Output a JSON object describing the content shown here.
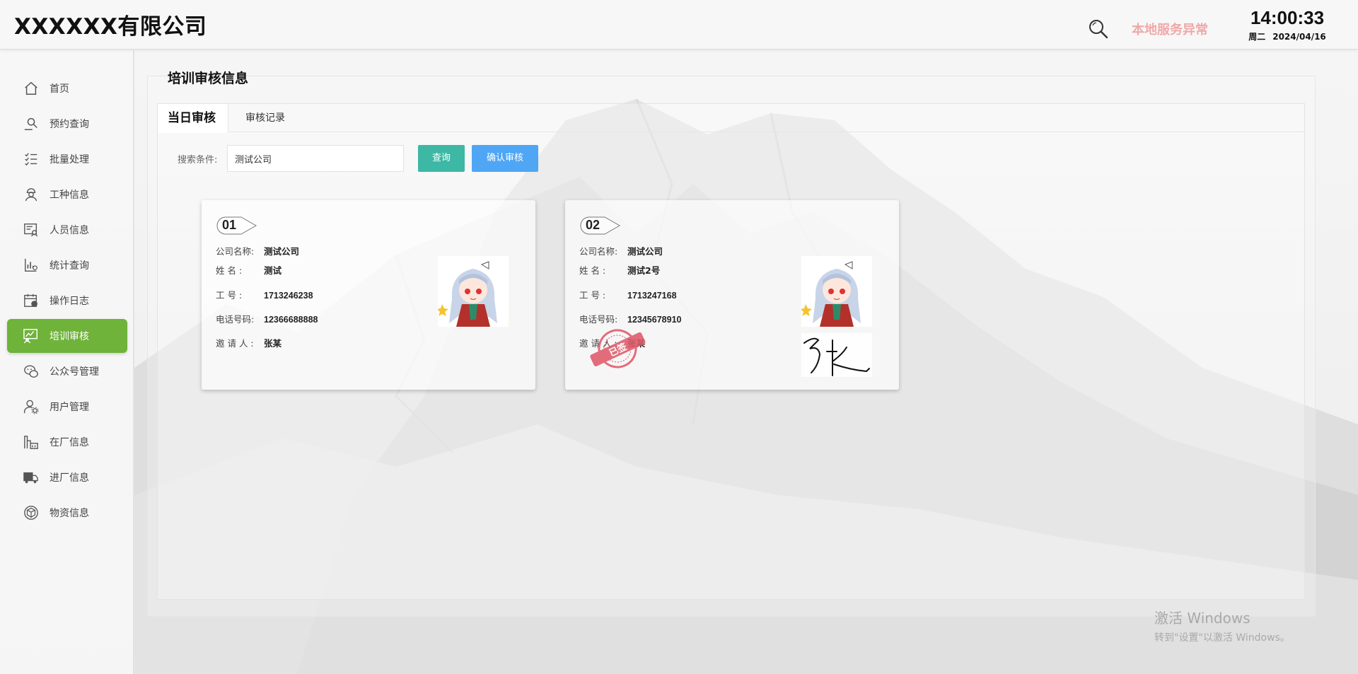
{
  "header": {
    "company_name": "XXXXXX有限公司",
    "search_icon": "search-icon",
    "service_status": "本地服务异常",
    "time": "14:00:33",
    "weekday": "周二",
    "date": "2024/04/16"
  },
  "sidebar": {
    "items": [
      {
        "label": "首页",
        "icon": "home-icon"
      },
      {
        "label": "预约查询",
        "icon": "search-person-icon"
      },
      {
        "label": "批量处理",
        "icon": "checklist-icon"
      },
      {
        "label": "工种信息",
        "icon": "worker-icon"
      },
      {
        "label": "人员信息",
        "icon": "person-card-icon"
      },
      {
        "label": "统计查询",
        "icon": "stats-icon"
      },
      {
        "label": "操作日志",
        "icon": "calendar-icon"
      },
      {
        "label": "培训审核",
        "icon": "training-icon",
        "active": true
      },
      {
        "label": "公众号管理",
        "icon": "chat-icon"
      },
      {
        "label": "用户管理",
        "icon": "user-settings-icon"
      },
      {
        "label": "在厂信息",
        "icon": "factory-icon"
      },
      {
        "label": "进厂信息",
        "icon": "truck-icon"
      },
      {
        "label": "物资信息",
        "icon": "box-icon"
      }
    ],
    "active_color": "#6fb33a"
  },
  "main": {
    "title": "培训审核信息",
    "tabs": [
      {
        "label": "当日审核",
        "active": true
      },
      {
        "label": "审核记录"
      }
    ],
    "search": {
      "label": "搜索条件:",
      "value": "测试公司"
    },
    "query_button": "查询",
    "confirm_button": "确认审核",
    "cards": [
      {
        "number": "01",
        "company_label": "公司名称:",
        "company": "测试公司",
        "name_label": "姓    名   :",
        "name": "测试",
        "id_label": "工    号   :",
        "id": "1713246238",
        "phone_label": "电话号码:",
        "phone": "12366688888",
        "inviter_label": "邀 请 人 :",
        "inviter": "张某",
        "signed": false
      },
      {
        "number": "02",
        "company_label": "公司名称:",
        "company": "测试公司",
        "name_label": "姓    名   :",
        "name": "测试2号",
        "id_label": "工    号   :",
        "id": "1713247168",
        "phone_label": "电话号码:",
        "phone": "12345678910",
        "inviter_label": "邀 请 人 :",
        "inviter": "张某",
        "signed": true,
        "stamp_text": "已签"
      }
    ]
  },
  "watermark": {
    "line1": "激活 Windows",
    "line2": "转到\"设置\"以激活 Windows。"
  }
}
